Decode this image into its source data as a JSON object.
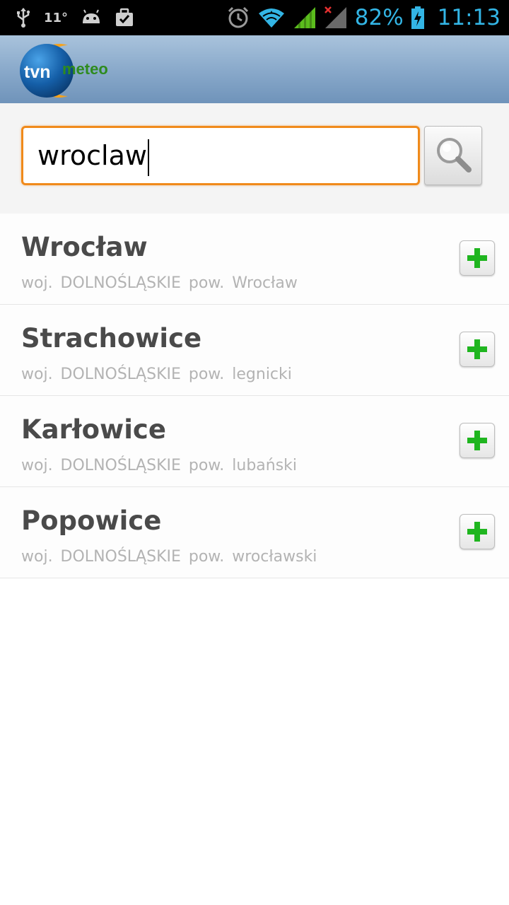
{
  "status_bar": {
    "temperature": "11°",
    "battery_percent": "82%",
    "time": "11:13",
    "icons": [
      "usb-icon",
      "android-icon",
      "briefcase-icon",
      "alarm-icon",
      "wifi-icon",
      "signal-icon",
      "no-signal-icon",
      "battery-charging-icon"
    ]
  },
  "header": {
    "logo_text_left": "tvn",
    "logo_text_right": "meteo"
  },
  "search": {
    "value": "wroclaw",
    "button_icon": "magnifier-icon"
  },
  "results": [
    {
      "name": "Wrocław",
      "region": "woj. DOLNOŚLĄSKIE pow. Wrocław"
    },
    {
      "name": "Strachowice",
      "region": "woj. DOLNOŚLĄSKIE pow. legnicki"
    },
    {
      "name": "Karłowice",
      "region": "woj. DOLNOŚLĄSKIE pow. lubański"
    },
    {
      "name": "Popowice",
      "region": "woj. DOLNOŚLĄSKIE pow. wrocławski"
    }
  ],
  "colors": {
    "accent_orange": "#f08a1b",
    "status_blue": "#33b5e5",
    "add_green": "#1fb51f",
    "header_blue": "#8aaacb"
  }
}
